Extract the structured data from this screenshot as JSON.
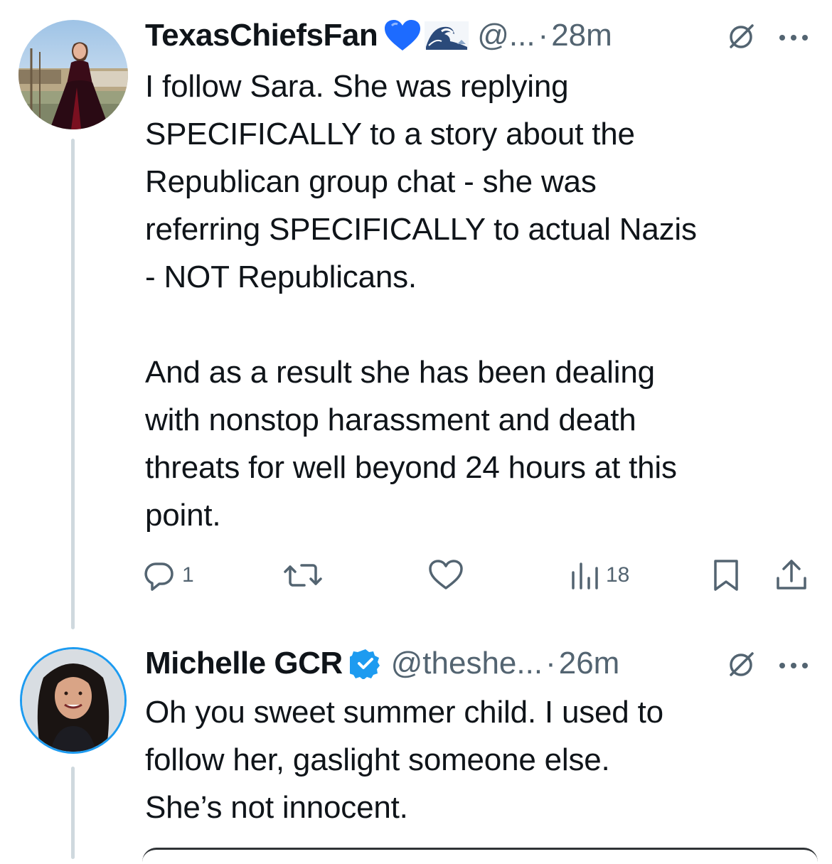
{
  "tweets": [
    {
      "display_name": "TexasChiefsFan",
      "emoji": [
        "blue-heart",
        "wave"
      ],
      "handle": "@...",
      "separator": "·",
      "time": "28m",
      "text": "I follow Sara. She was replying\nSPECIFICALLY to a story about the\nRepublican group chat - she was\nreferring SPECIFICALLY to actual Nazis\n- NOT Republicans.\n\nAnd as a result she has been dealing\nwith nonstop harassment and death\nthreats for well beyond 24 hours at this\npoint.",
      "actions": {
        "reply": {
          "icon": "reply-icon",
          "count": "1"
        },
        "repost": {
          "icon": "repost-icon",
          "count": ""
        },
        "like": {
          "icon": "heart-icon",
          "count": ""
        },
        "views": {
          "icon": "views-icon",
          "count": "18"
        },
        "bookmark": {
          "icon": "bookmark-icon"
        },
        "share": {
          "icon": "share-icon"
        }
      }
    },
    {
      "display_name": "Michelle GCR",
      "verified": true,
      "handle": "@theshe...",
      "separator": "·",
      "time": "26m",
      "text": "Oh you sweet summer child. I used to\nfollow her, gaslight someone else.\nShe’s not innocent."
    }
  ],
  "colors": {
    "text": "#0f1419",
    "secondary": "#536471",
    "verified_blue": "#1d9bf0",
    "heart_blue": "#1d6bff",
    "thread_line": "#cfd9de"
  }
}
